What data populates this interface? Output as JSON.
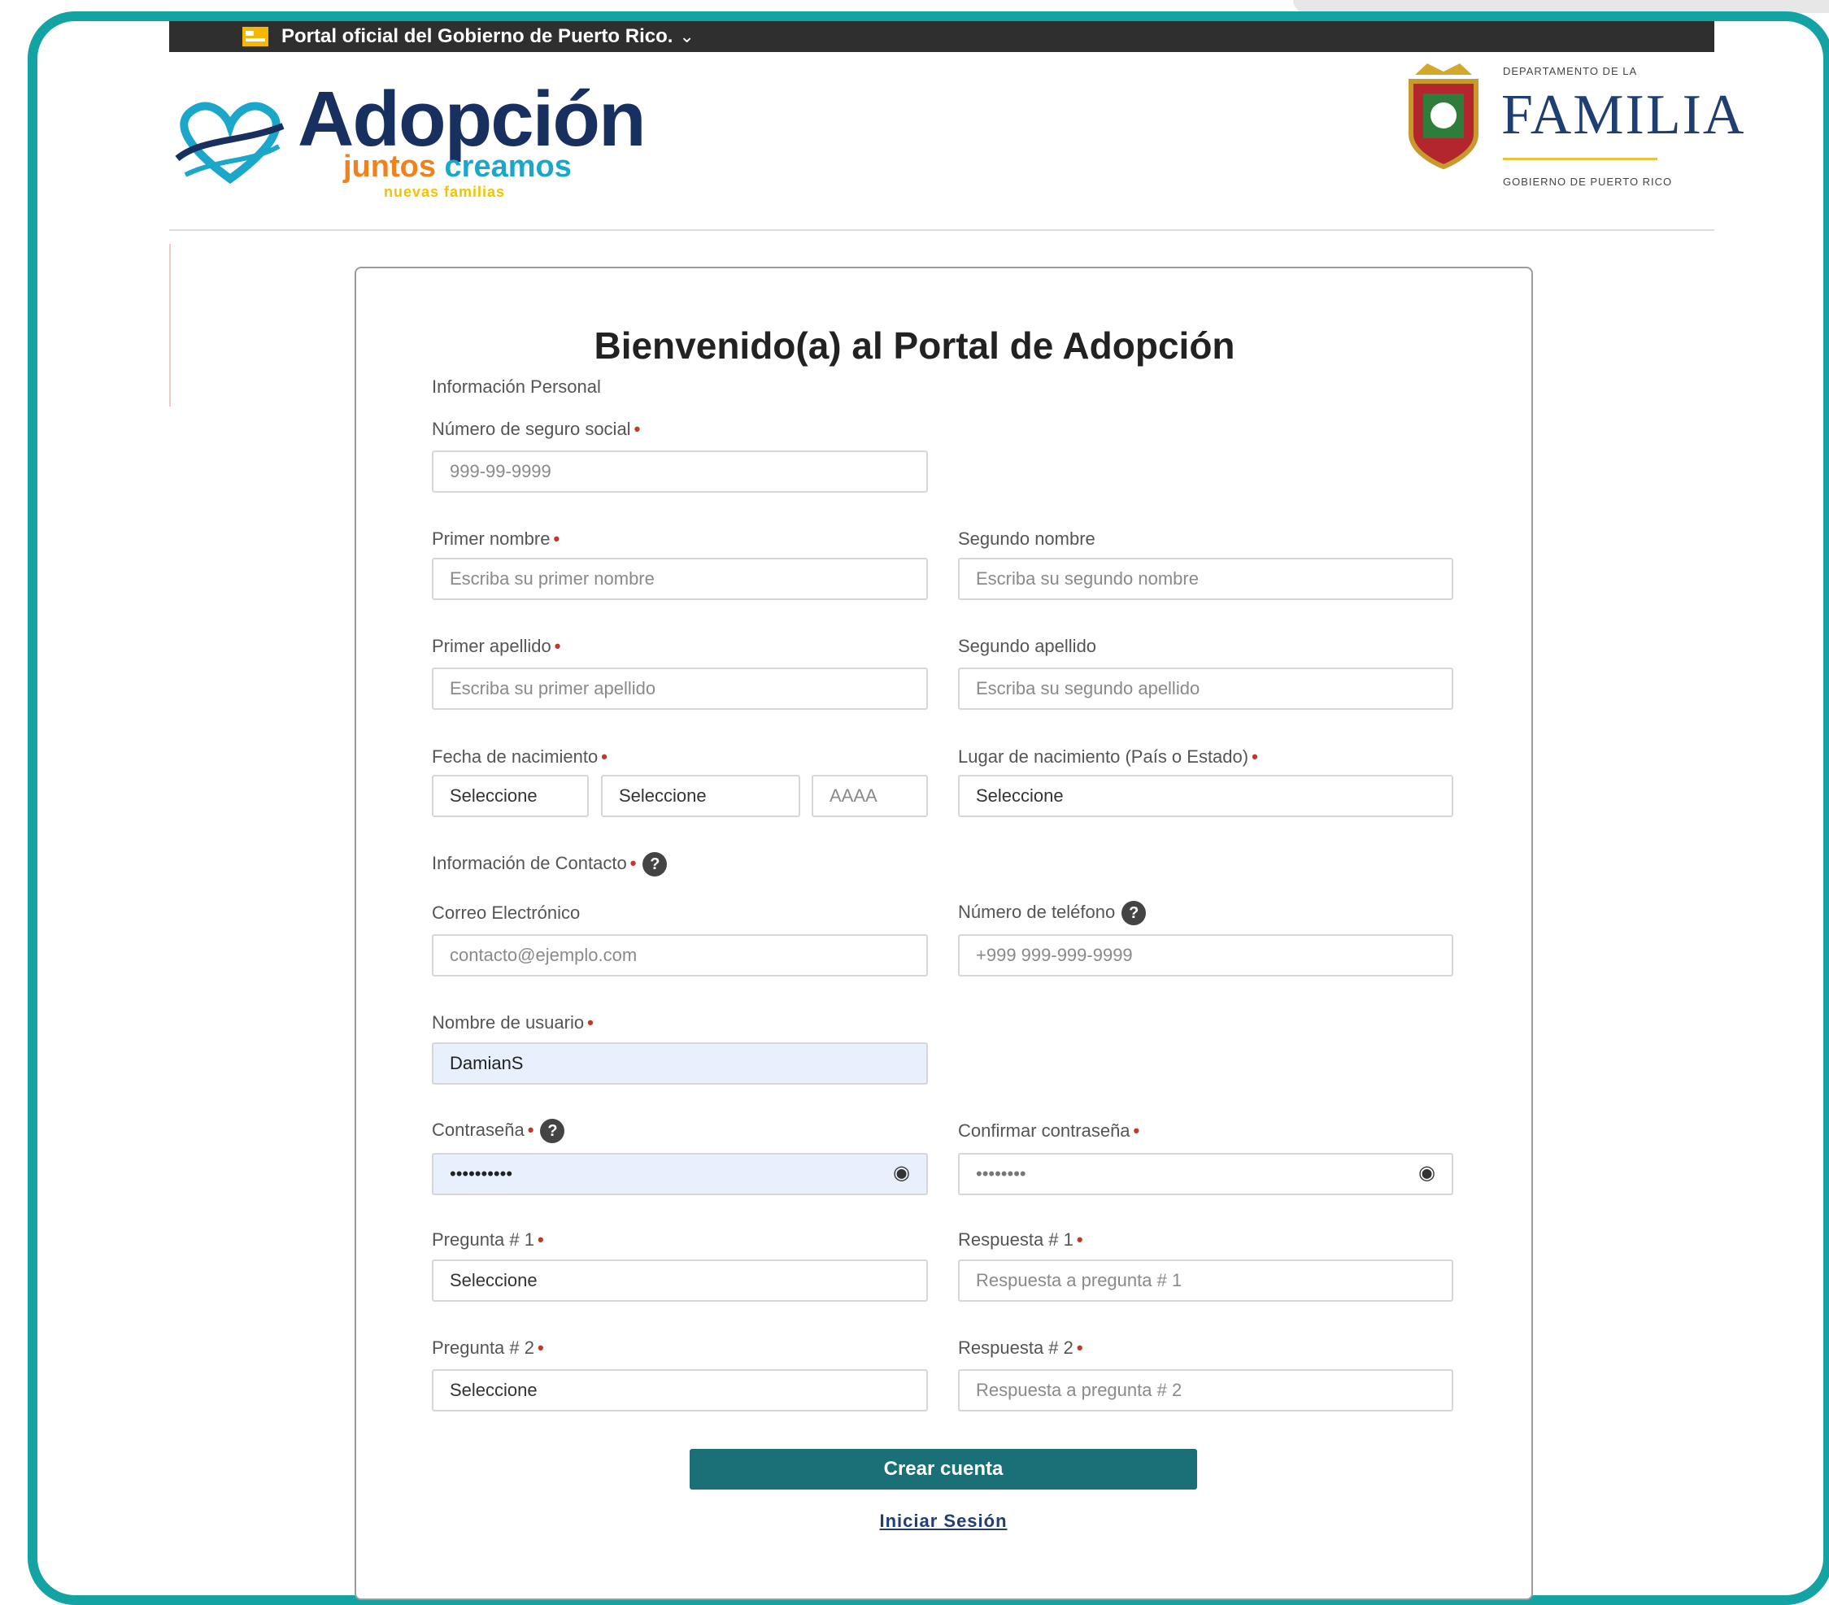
{
  "gov_bar": {
    "text": "Portal oficial del Gobierno de Puerto Rico."
  },
  "header": {
    "logo_title": "Adopción",
    "logo_sub_1": "juntos",
    "logo_sub_2": "creamos",
    "logo_sub_3": "nuevas familias",
    "dept_small": "DEPARTAMENTO DE LA",
    "dept_name": "FAMILIA",
    "dept_gov": "GOBIERNO DE PUERTO RICO"
  },
  "form": {
    "title": "Bienvenido(a) al Portal de Adopción",
    "section_personal": "Información Personal",
    "ssn_label": "Número de seguro social",
    "ssn_placeholder": "999-99-9999",
    "first_name_label": "Primer nombre",
    "first_name_placeholder": "Escriba su primer nombre",
    "second_name_label": "Segundo nombre",
    "second_name_placeholder": "Escriba su segundo nombre",
    "first_last_label": "Primer apellido",
    "first_last_placeholder": "Escriba su primer apellido",
    "second_last_label": "Segundo apellido",
    "second_last_placeholder": "Escriba su segundo apellido",
    "birth_date_label": "Fecha de nacimiento",
    "birth_day": "Seleccione",
    "birth_month": "Seleccione",
    "birth_year_placeholder": "AAAA",
    "birth_place_label": "Lugar de nacimiento (País o Estado)",
    "birth_place": "Seleccione",
    "section_contact": "Información de Contacto",
    "email_label": "Correo Electrónico",
    "email_placeholder": "contacto@ejemplo.com",
    "phone_label": "Número de teléfono",
    "phone_placeholder": "+999 999-999-9999",
    "username_label": "Nombre de usuario",
    "username_value": "DamianS",
    "password_label": "Contraseña",
    "password_value": "••••••••••",
    "confirm_label": "Confirmar contraseña",
    "confirm_placeholder": "••••••••",
    "q1_label": "Pregunta # 1",
    "q1_value": "Seleccione",
    "a1_label": "Respuesta # 1",
    "a1_placeholder": "Respuesta a pregunta # 1",
    "q2_label": "Pregunta # 2",
    "q2_value": "Seleccione",
    "a2_label": "Respuesta # 2",
    "a2_placeholder": "Respuesta a pregunta # 2",
    "submit_label": "Crear cuenta",
    "login_label": "Iniciar Sesión"
  },
  "colors": {
    "frame": "#13a3a3",
    "button": "#1b6f76",
    "brand_navy": "#18305f"
  }
}
